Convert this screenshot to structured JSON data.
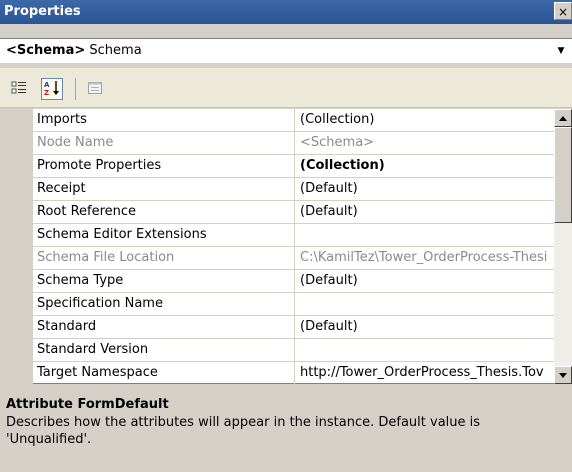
{
  "window": {
    "title": "Properties",
    "close": "×"
  },
  "selector": {
    "object_type": "<Schema>",
    "object_name": "Schema"
  },
  "toolbar": {
    "categorized_icon": "categorized-icon",
    "alphabetical_icon": "alphabetical-icon",
    "property_pages_icon": "property-pages-icon"
  },
  "properties": [
    {
      "name": "Imports",
      "value": "(Collection)",
      "disabled": false,
      "bold": false
    },
    {
      "name": "Node Name",
      "value": "<Schema>",
      "disabled": true,
      "bold": false
    },
    {
      "name": "Promote Properties",
      "value": "(Collection)",
      "disabled": false,
      "bold": true
    },
    {
      "name": "Receipt",
      "value": "(Default)",
      "disabled": false,
      "bold": false
    },
    {
      "name": "Root Reference",
      "value": "(Default)",
      "disabled": false,
      "bold": false
    },
    {
      "name": "Schema Editor Extensions",
      "value": "",
      "disabled": false,
      "bold": false
    },
    {
      "name": "Schema File Location",
      "value": "C:\\KamilTez\\Tower_OrderProcess-Thesi",
      "disabled": true,
      "bold": false
    },
    {
      "name": "Schema Type",
      "value": "(Default)",
      "disabled": false,
      "bold": false
    },
    {
      "name": "Specification Name",
      "value": "",
      "disabled": false,
      "bold": false
    },
    {
      "name": "Standard",
      "value": "(Default)",
      "disabled": false,
      "bold": false
    },
    {
      "name": "Standard Version",
      "value": "",
      "disabled": false,
      "bold": false
    },
    {
      "name": "Target Namespace",
      "value": "http://Tower_OrderProcess_Thesis.Tov",
      "disabled": false,
      "bold": false
    }
  ],
  "description": {
    "title": "Attribute FormDefault",
    "text": "Describes how the attributes will appear in the instance. Default value is 'Unqualified'."
  },
  "colors": {
    "titlebar": "#2a5496",
    "panel": "#d4d0c8",
    "disabled_text": "#8a8a8a"
  }
}
